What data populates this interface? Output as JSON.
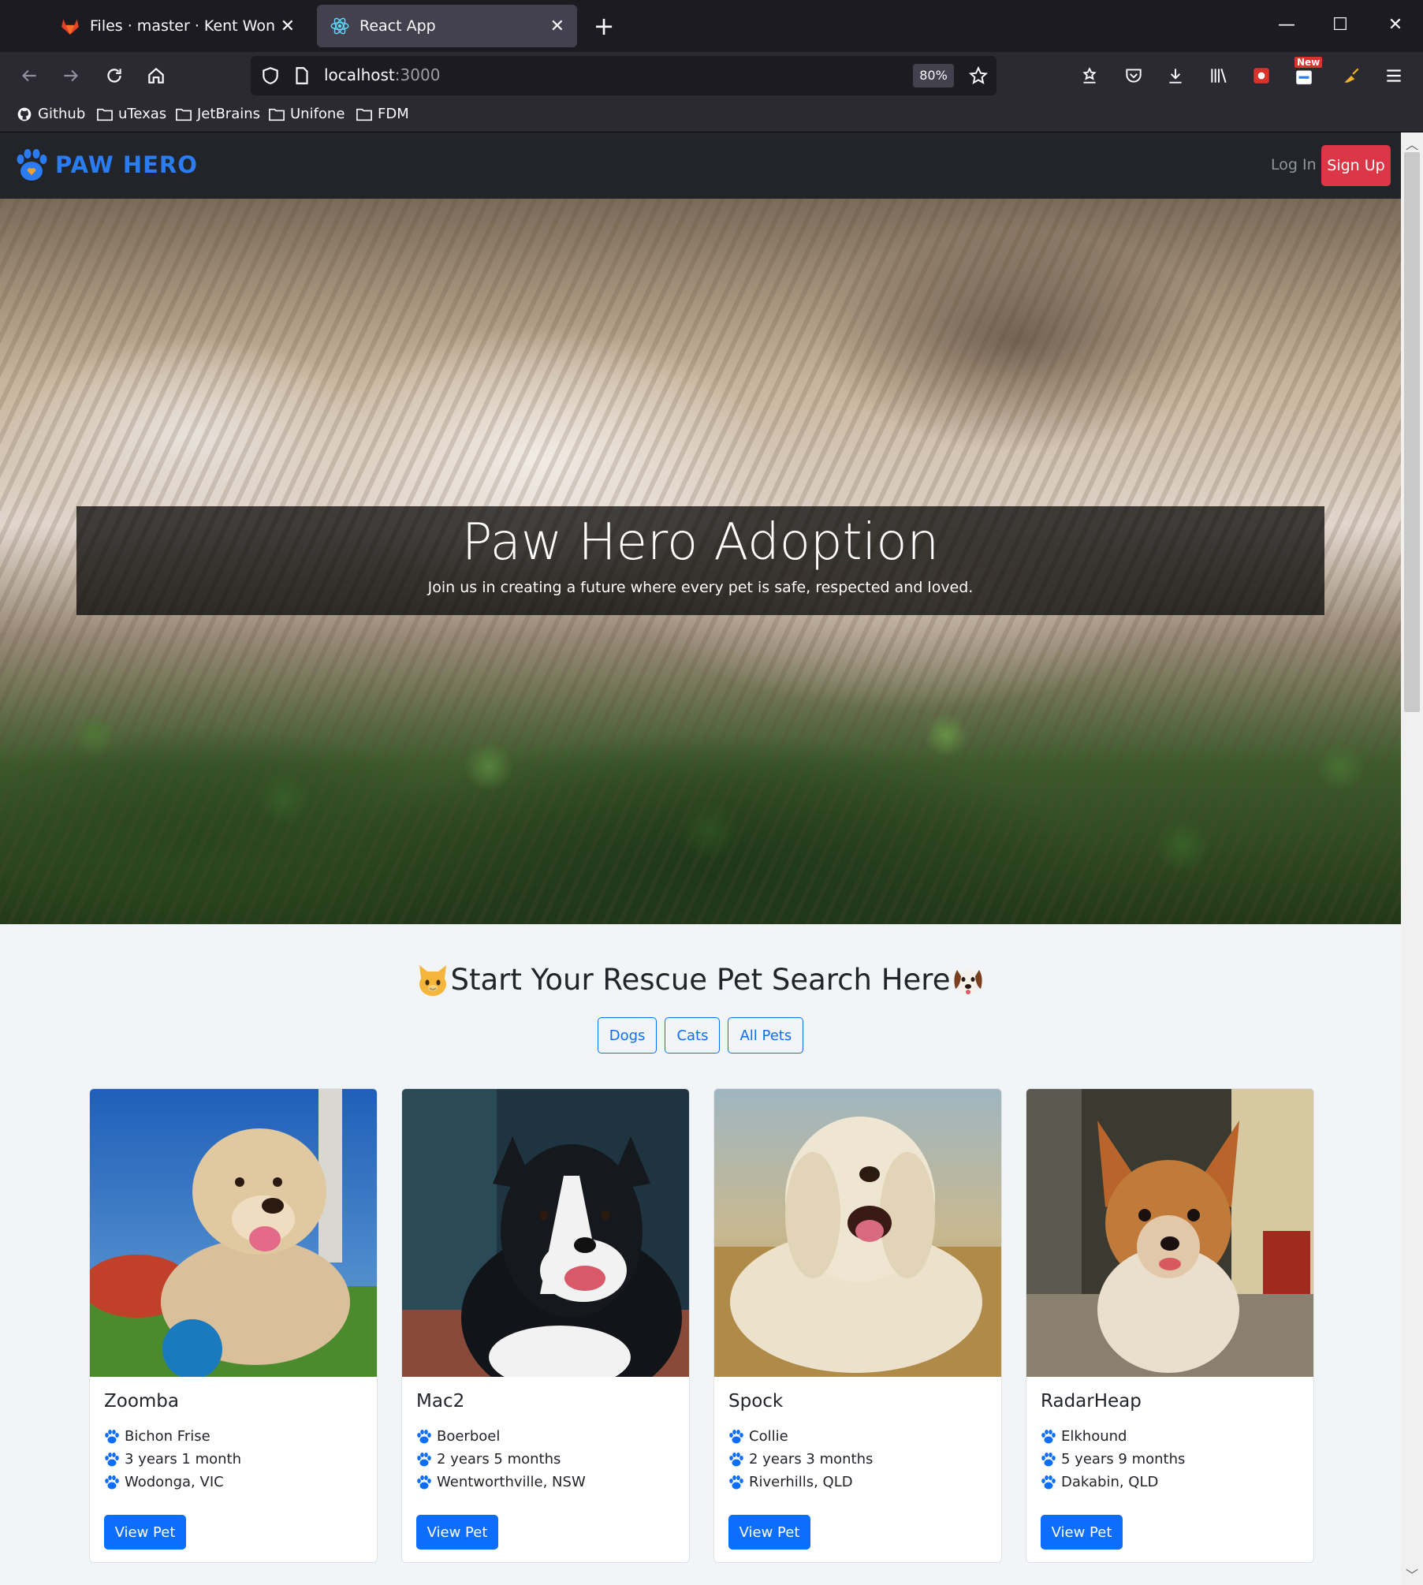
{
  "browser": {
    "tabs": [
      {
        "title": "Files · master · Kent Wong / Paw Hero",
        "active": false
      },
      {
        "title": "React App",
        "active": true
      }
    ],
    "url_host": "localhost",
    "url_port": ":3000",
    "zoom": "80%",
    "bookmarks": [
      "Github",
      "uTexas",
      "JetBrains",
      "Unifone",
      "FDM"
    ],
    "badge_new": "New"
  },
  "site": {
    "brand": "PAW HERO",
    "login_label": "Log In",
    "signup_label": "Sign Up",
    "colors": {
      "brand": "#2b7bf2",
      "signup": "#dc3545",
      "primary": "#0d6efd",
      "nav": "#212529"
    }
  },
  "hero": {
    "title": "Paw Hero Adoption",
    "subtitle": "Join us in creating a future where every pet is safe, respected and loved."
  },
  "search": {
    "title": "Start Your Rescue Pet Search Here",
    "filters": [
      "Dogs",
      "Cats",
      "All Pets"
    ]
  },
  "pets": [
    {
      "name": "Zoomba",
      "breed": "Bichon Frise",
      "age": "3 years 1 month",
      "location": "Wodonga, VIC",
      "button": "View Pet"
    },
    {
      "name": "Mac2",
      "breed": "Boerboel",
      "age": "2 years 5 months",
      "location": "Wentworthville, NSW",
      "button": "View Pet"
    },
    {
      "name": "Spock",
      "breed": "Collie",
      "age": "2 years 3 months",
      "location": "Riverhills, QLD",
      "button": "View Pet"
    },
    {
      "name": "RadarHeap",
      "breed": "Elkhound",
      "age": "5 years 9 months",
      "location": "Dakabin, QLD",
      "button": "View Pet"
    }
  ]
}
